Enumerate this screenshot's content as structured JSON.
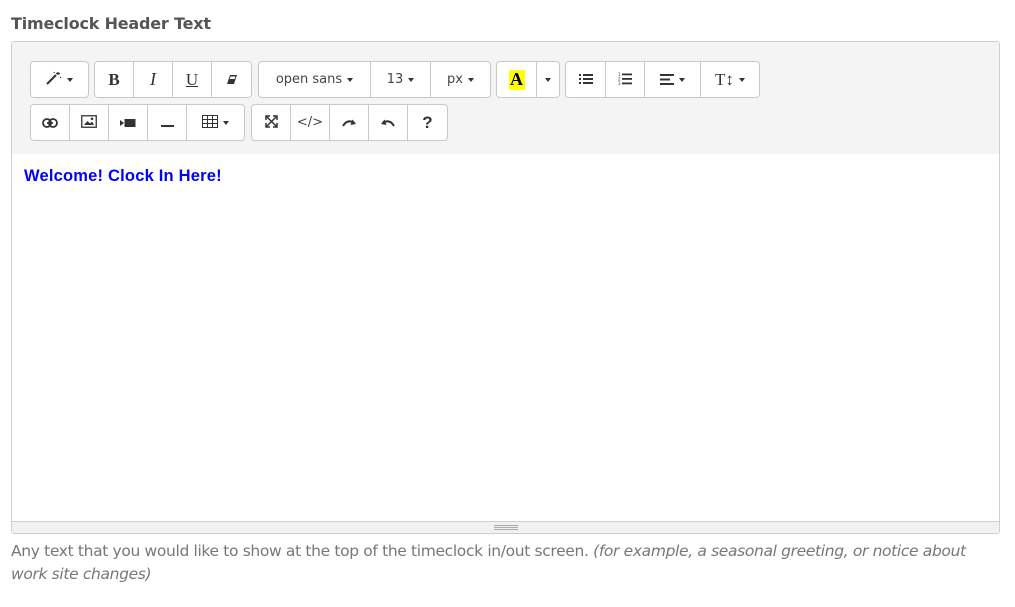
{
  "field": {
    "label": "Timeclock Header Text",
    "help_main": "Any text that you would like to show at the top of the timeclock in/out screen.",
    "help_example": "(for example, a seasonal greeting, or notice about work site changes)"
  },
  "toolbar": {
    "style_icon": "magic-wand-icon",
    "bold_label": "B",
    "italic_label": "I",
    "underline_label": "U",
    "eraser_icon": "eraser-icon",
    "font_family": "open sans",
    "font_size": "13",
    "font_unit": "px",
    "highlight_label": "A",
    "highlight_color": "#ffff00",
    "ul_icon": "unordered-list-icon",
    "ol_icon": "ordered-list-icon",
    "align_icon": "align-left-icon",
    "line_height_label": "T↕",
    "link_icon": "link-icon",
    "image_icon": "image-icon",
    "video_icon": "video-icon",
    "hr_icon": "horizontal-rule-icon",
    "table_icon": "table-icon",
    "fullscreen_icon": "fullscreen-icon",
    "code_view_label": "</>",
    "redo_icon": "redo-icon",
    "undo_icon": "undo-icon",
    "help_label": "?"
  },
  "editor": {
    "content_text": "Welcome! Clock In Here!",
    "content_color": "#0000ff"
  }
}
